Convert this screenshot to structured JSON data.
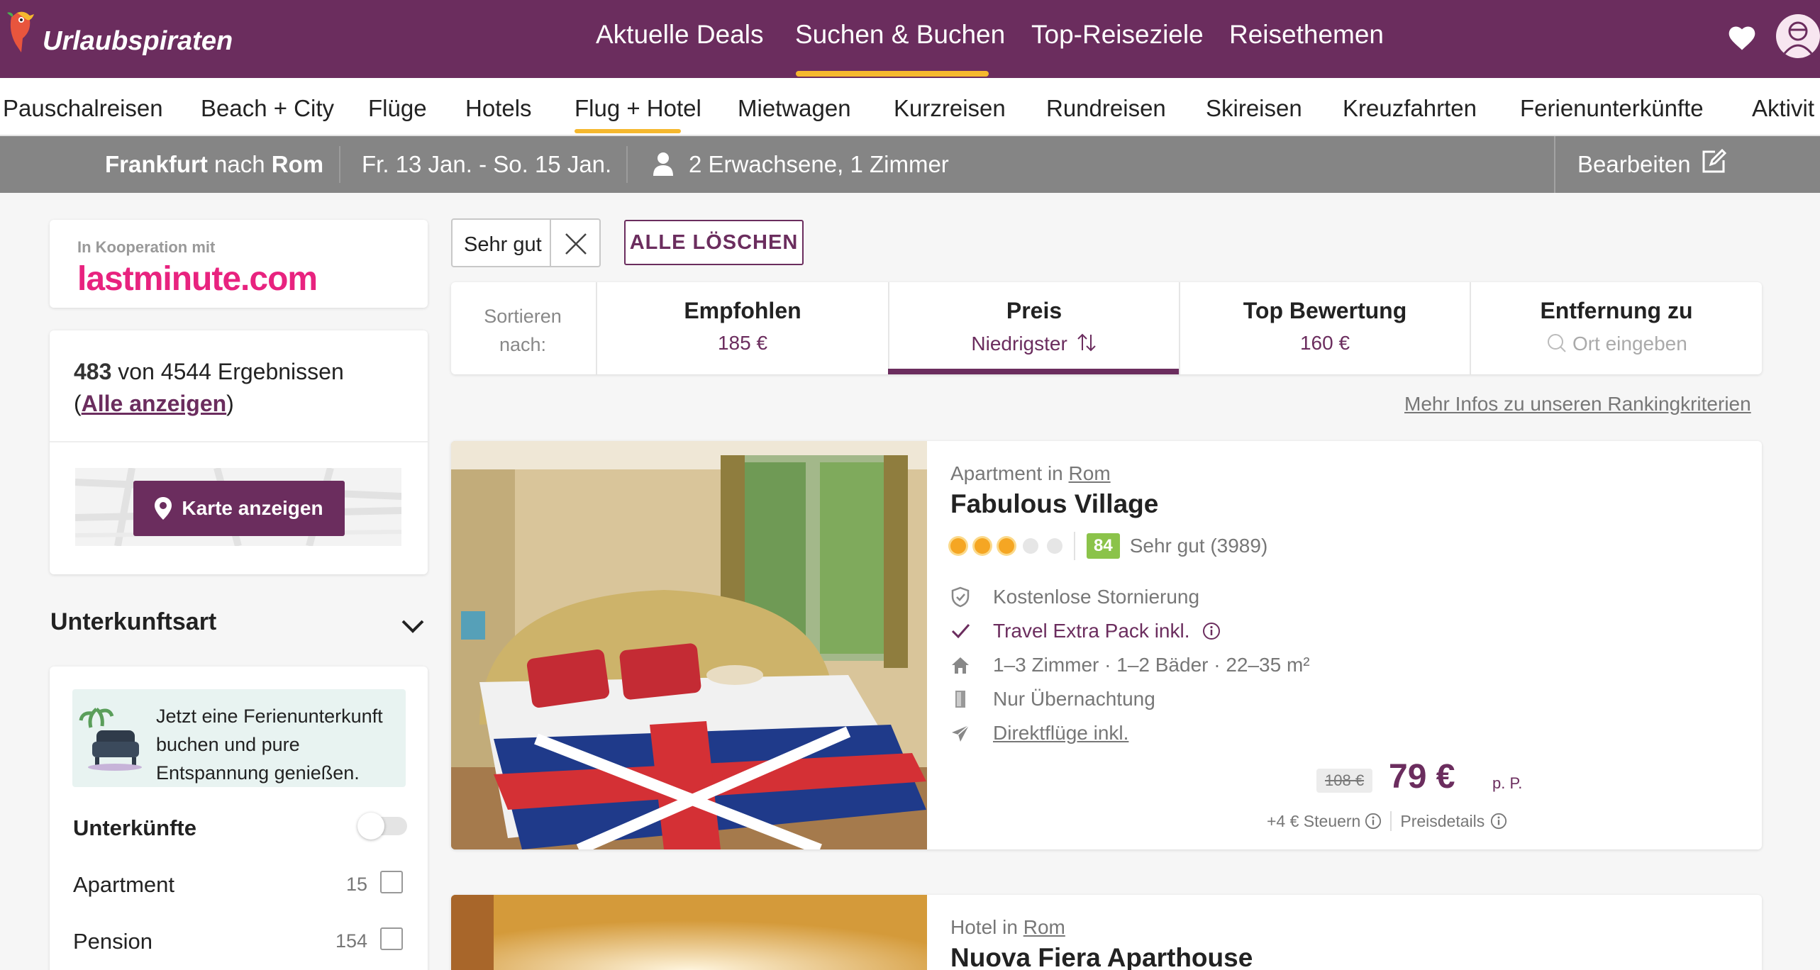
{
  "brand": {
    "name": "Urlaubspiraten"
  },
  "topnav": {
    "items": [
      "Aktuelle Deals",
      "Suchen & Buchen",
      "Top-Reiseziele",
      "Reisethemen"
    ],
    "active": "Suchen & Buchen"
  },
  "subnav": {
    "items": [
      "Pauschalreisen",
      "Beach + City",
      "Flüge",
      "Hotels",
      "Flug + Hotel",
      "Mietwagen",
      "Kurzreisen",
      "Rundreisen",
      "Skireisen",
      "Kreuzfahrten",
      "Ferienunterkünfte",
      "Aktivit"
    ],
    "active": "Flug + Hotel"
  },
  "search": {
    "from": "Frankfurt",
    "connector": "nach",
    "to": "Rom",
    "dates": "Fr. 13 Jan. - So. 15 Jan.",
    "guests": "2 Erwachsene, 1 Zimmer",
    "edit_label": "Bearbeiten"
  },
  "sidebar": {
    "partner_caption": "In Kooperation mit",
    "partner_name": "lastminute.com",
    "results_count": "483",
    "results_text": "von 4544 Ergebnissen",
    "show_all": "Alle anzeigen",
    "map_button": "Karte anzeigen",
    "section_title": "Unterkunftsart",
    "promo_text": "Jetzt eine Ferienunterkunft buchen und pure Entspannung genießen.",
    "toggle_label": "Unterkünfte",
    "types": [
      {
        "label": "Apartment",
        "count": "15"
      },
      {
        "label": "Pension",
        "count": "154"
      }
    ]
  },
  "filters": {
    "chip": "Sehr gut",
    "clear_all": "ALLE LÖSCHEN"
  },
  "sort": {
    "label_line1": "Sortieren",
    "label_line2": "nach:",
    "options": [
      {
        "title": "Empfohlen",
        "value": "185 €"
      },
      {
        "title": "Preis",
        "value": "Niedrigster"
      },
      {
        "title": "Top Bewertung",
        "value": "160 €"
      },
      {
        "title": "Entfernung zu",
        "value": "Ort eingeben"
      }
    ],
    "active": "Preis"
  },
  "ranking_link": "Mehr Infos zu unseren Rankingkriterien",
  "hotels": [
    {
      "type": "Apartment in",
      "city": "Rom",
      "name": "Fabulous Village",
      "stars": 3,
      "score": "84",
      "rating_text": "Sehr gut (3989)",
      "features": [
        "Kostenlose Stornierung",
        "Travel Extra Pack inkl.",
        "1–3 Zimmer · 1–2 Bäder · 22–35 m²",
        "Nur Übernachtung",
        "Direktflüge inkl."
      ],
      "old_price": "108 €",
      "price": "79 €",
      "price_unit": "p. P.",
      "taxes": "+4 € Steuern",
      "price_details": "Preisdetails"
    },
    {
      "type": "Hotel in",
      "city": "Rom",
      "name": "Nuova Fiera Aparthouse"
    }
  ],
  "colors": {
    "brand_purple": "#6b2d5e",
    "accent_yellow": "#f5b82e",
    "score_green": "#8bc34a",
    "partner_pink": "#e8237f"
  }
}
